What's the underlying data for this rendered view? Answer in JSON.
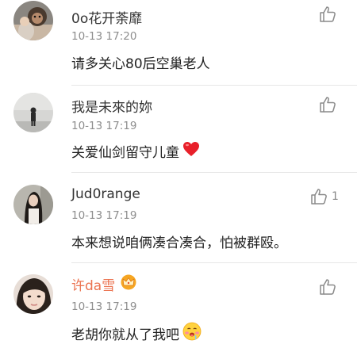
{
  "comments": [
    {
      "username": "0o花开荼靡",
      "time": "10-13 17:20",
      "text": "请多关心80后空巢老人",
      "avatar_icon": "avatar-monkey-photo",
      "like_count": ""
    },
    {
      "username": "我是未來的妳",
      "time": "10-13 17:19",
      "text": "关爱仙剑留守儿童",
      "avatar_icon": "avatar-person-wall-photo",
      "trailing_icon": "red-heart-emoji",
      "like_count": ""
    },
    {
      "username": "Jud0range",
      "time": "10-13 17:19",
      "text": "本来想说咱俩凑合凑合，怕被群殴。",
      "avatar_icon": "avatar-girl-photo",
      "like_count": "1"
    },
    {
      "username": "许da雪",
      "time": "10-13 17:19",
      "text": "老胡你就从了我吧",
      "avatar_icon": "avatar-girl-closeup-photo",
      "badge_icon": "vip-crown-icon",
      "trailing_icon": "drooling-face-emoji",
      "like_count": ""
    }
  ],
  "colors": {
    "username": "#333333",
    "vip_username": "#eb7350",
    "timestamp": "#8d8d8d",
    "divider": "#e6e6e6"
  }
}
